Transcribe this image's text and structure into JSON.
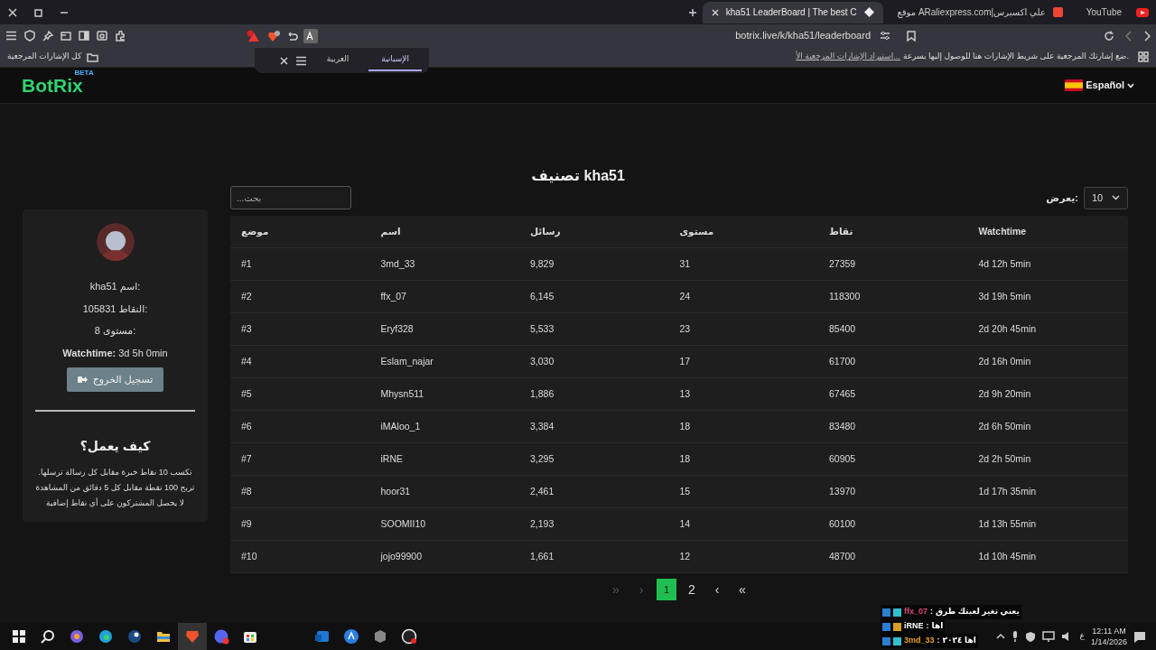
{
  "browser": {
    "tabs": [
      {
        "title": "YouTube",
        "selected": false
      },
      {
        "title": "موقع ARaliexpress.com|علي اكسبرس",
        "selected": false
      },
      {
        "title": "kha51 LeaderBoard | The best C",
        "selected": true
      }
    ],
    "address": "botrix.live/k/kha51/leaderboard",
    "bookmarks_bar": {
      "folder": "كل الإشارات المرجعية",
      "hint": "ضع إشارتك المرجعية على شريط الإشارات هنا للوصول إليها بسرعة.",
      "import_link": "استيراد الإشارات المرجعية الأ..."
    },
    "translate_popup": {
      "languages": [
        {
          "label": "الإسبانية",
          "selected": true
        },
        {
          "label": "العربية",
          "selected": false
        }
      ]
    }
  },
  "site": {
    "logo": "BotRix",
    "logo_badge": "BETA",
    "language": "Español"
  },
  "title": "تصنيف kha51",
  "search": {
    "placeholder": "...بحث"
  },
  "page_size": {
    "label": "يعرض:",
    "value": "10"
  },
  "profile": {
    "lines": [
      "kha51 اسم:",
      "105831 النقاط:",
      "8 مستوى:",
      "**Watchtime:** 3d 5h 0min"
    ],
    "logout": "تسجيل الخروج",
    "how_title": "كيف يعمل؟",
    "how_lines": [
      "تكسب 10 نقاط خبرة مقابل كل رسالة ترسلها.",
      "تربح 100 نقطة مقابل كل 5 دقائق من المشاهدة",
      "لا يحصل المشتركون على أي نقاط إضافية"
    ]
  },
  "table": {
    "columns": [
      "Watchtime",
      "نقاط",
      "مستوى",
      "رسائل",
      "اسم",
      "موضع"
    ],
    "rows": [
      [
        "4d 12h 5min",
        "27359",
        "31",
        "9,829",
        "3md_33",
        "#1"
      ],
      [
        "3d 19h 5min",
        "118300",
        "24",
        "6,145",
        "ffx_07",
        "#2"
      ],
      [
        "2d 20h 45min",
        "85400",
        "23",
        "5,533",
        "Eryf328",
        "#3"
      ],
      [
        "2d 16h 0min",
        "61700",
        "17",
        "3,030",
        "Eslam_najar",
        "#4"
      ],
      [
        "2d 9h 20min",
        "67465",
        "13",
        "1,886",
        "Mhysn511",
        "#5"
      ],
      [
        "2d 6h 50min",
        "83480",
        "18",
        "3,384",
        "iMAloo_1",
        "#6"
      ],
      [
        "2d 2h 50min",
        "60905",
        "18",
        "3,295",
        "iRNE",
        "#7"
      ],
      [
        "1d 17h 35min",
        "13970",
        "15",
        "2,461",
        "hoor31",
        "#8"
      ],
      [
        "1d 13h 55min",
        "60100",
        "14",
        "2,193",
        "SOOMII10",
        "#9"
      ],
      [
        "1d 10h 45min",
        "48700",
        "12",
        "1,661",
        "jojo99900",
        "#10"
      ]
    ]
  },
  "pagination": [
    {
      "label": "»",
      "disabled": false,
      "selected": false
    },
    {
      "label": "›",
      "disabled": false,
      "selected": false
    },
    {
      "label": "2",
      "disabled": false,
      "selected": false
    },
    {
      "label": "1",
      "disabled": false,
      "selected": true
    },
    {
      "label": "‹",
      "disabled": true,
      "selected": false
    },
    {
      "label": "«",
      "disabled": true,
      "selected": false
    }
  ],
  "chat": [
    {
      "user": "ffx_07",
      "separator": ":",
      "message": "يعني تغير لعبتك طرق",
      "color": "#e0457b"
    },
    {
      "user": "iRNE",
      "separator": ":",
      "message": "اها",
      "color": "#ffffff"
    },
    {
      "user": "3md_33",
      "separator": ":",
      "message": "اها ٢٠٢٤",
      "color": "#e8a020"
    }
  ],
  "taskbar": {
    "language": "ع",
    "time": "12:11 AM",
    "date": "1/14/2026"
  }
}
